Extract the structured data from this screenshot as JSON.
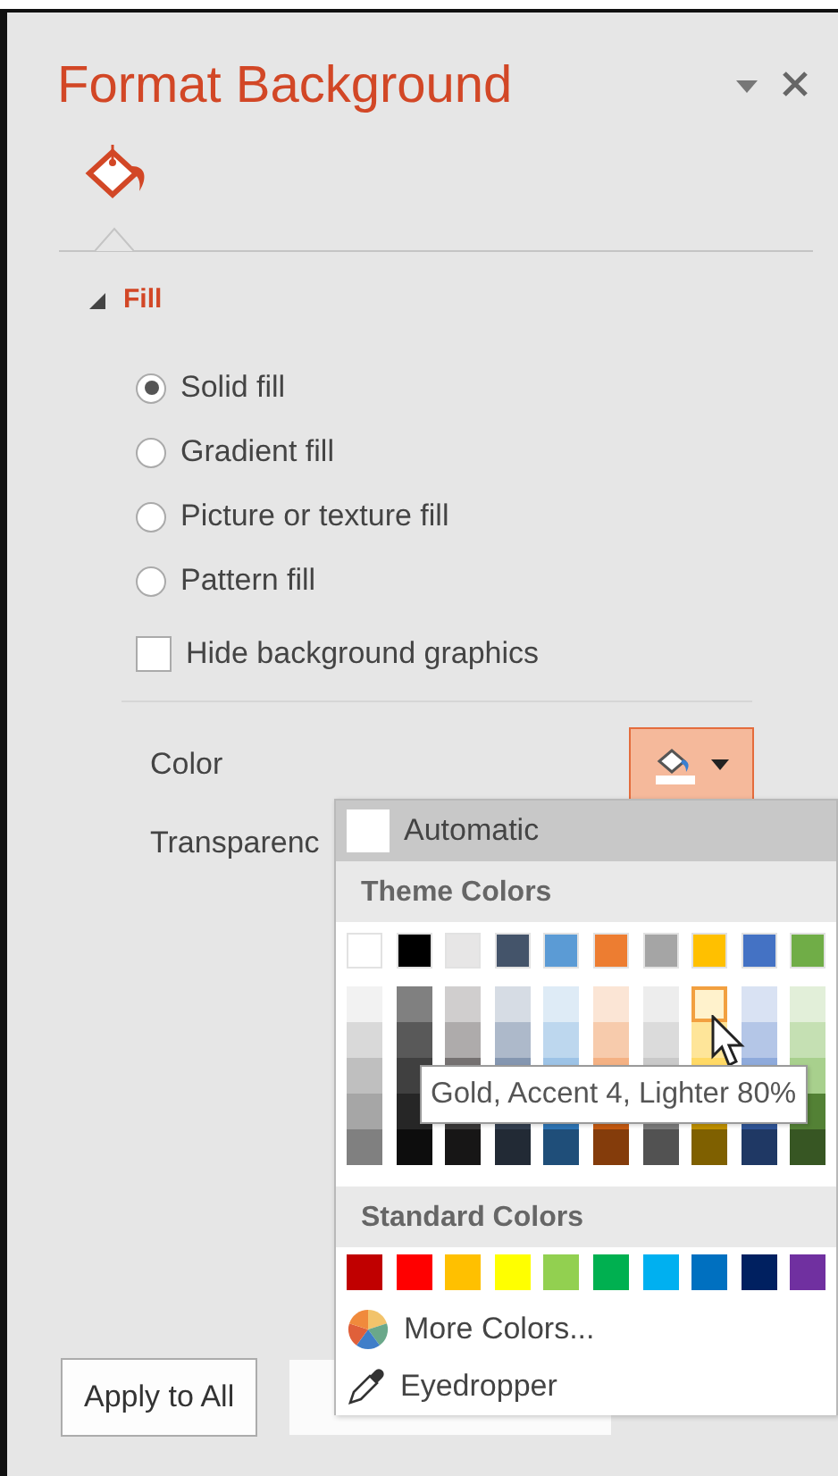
{
  "panel": {
    "title": "Format Background",
    "tabs": [
      {
        "kind": "fill",
        "selected": true
      }
    ]
  },
  "section": {
    "title": "Fill",
    "expanded": true
  },
  "fill_options": [
    {
      "label": "Solid fill",
      "selected": true
    },
    {
      "label": "Gradient fill",
      "selected": false
    },
    {
      "label": "Picture or texture fill",
      "selected": false
    },
    {
      "label": "Pattern fill",
      "selected": false
    }
  ],
  "hide_background_graphics": {
    "label": "Hide background graphics",
    "checked": false
  },
  "color": {
    "label": "Color",
    "expanded": true
  },
  "transparency": {
    "label": "Transparenc"
  },
  "buttons": [
    {
      "kind": "text",
      "label": "Apply to All"
    },
    {
      "kind": "covered"
    }
  ],
  "color_menu": {
    "automatic": {
      "label": "Automatic",
      "selected": true
    },
    "theme_colors": {
      "title": "Theme Colors",
      "columns": [
        {
          "color": "#ffffff",
          "shades": [
            {
              "color": "#f2f2f2",
              "hovered": false
            },
            {
              "color": "#d9d9d9",
              "hovered": false
            },
            {
              "color": "#bfbfbf",
              "hovered": false
            },
            {
              "color": "#a6a6a6",
              "hovered": false
            },
            {
              "color": "#808080",
              "hovered": false
            }
          ]
        },
        {
          "color": "#000000",
          "shades": [
            {
              "color": "#808080",
              "hovered": false
            },
            {
              "color": "#595959",
              "hovered": false
            },
            {
              "color": "#404040",
              "hovered": false
            },
            {
              "color": "#262626",
              "hovered": false
            },
            {
              "color": "#0d0d0d",
              "hovered": false
            }
          ]
        },
        {
          "color": "#e7e6e6",
          "shades": [
            {
              "color": "#d0cece",
              "hovered": false
            },
            {
              "color": "#aeabab",
              "hovered": false
            },
            {
              "color": "#757171",
              "hovered": false
            },
            {
              "color": "#3a3838",
              "hovered": false
            },
            {
              "color": "#171616",
              "hovered": false
            }
          ]
        },
        {
          "color": "#44546a",
          "shades": [
            {
              "color": "#d6dce4",
              "hovered": false
            },
            {
              "color": "#adb9ca",
              "hovered": false
            },
            {
              "color": "#8496b0",
              "hovered": false
            },
            {
              "color": "#333f4f",
              "hovered": false
            },
            {
              "color": "#222a35",
              "hovered": false
            }
          ]
        },
        {
          "color": "#5b9bd5",
          "shades": [
            {
              "color": "#deebf6",
              "hovered": false
            },
            {
              "color": "#bdd7ee",
              "hovered": false
            },
            {
              "color": "#9dc3e6",
              "hovered": false
            },
            {
              "color": "#2e75b5",
              "hovered": false
            },
            {
              "color": "#1f4e79",
              "hovered": false
            }
          ]
        },
        {
          "color": "#ed7d31",
          "shades": [
            {
              "color": "#fbe5d5",
              "hovered": false
            },
            {
              "color": "#f7cbac",
              "hovered": false
            },
            {
              "color": "#f4b183",
              "hovered": false
            },
            {
              "color": "#c55a11",
              "hovered": false
            },
            {
              "color": "#843c0b",
              "hovered": false
            }
          ]
        },
        {
          "color": "#a5a5a5",
          "shades": [
            {
              "color": "#ededed",
              "hovered": false
            },
            {
              "color": "#dbdbdb",
              "hovered": false
            },
            {
              "color": "#c9c9c9",
              "hovered": false
            },
            {
              "color": "#7b7b7b",
              "hovered": false
            },
            {
              "color": "#525252",
              "hovered": false
            }
          ]
        },
        {
          "color": "#ffc000",
          "shades": [
            {
              "color": "#fff2cc",
              "hovered": true
            },
            {
              "color": "#fee599",
              "hovered": false
            },
            {
              "color": "#ffd965",
              "hovered": false
            },
            {
              "color": "#bf9000",
              "hovered": false
            },
            {
              "color": "#7f6000",
              "hovered": false
            }
          ]
        },
        {
          "color": "#4472c4",
          "shades": [
            {
              "color": "#d9e2f3",
              "hovered": false
            },
            {
              "color": "#b4c6e7",
              "hovered": false
            },
            {
              "color": "#8eaadb",
              "hovered": false
            },
            {
              "color": "#2f5496",
              "hovered": false
            },
            {
              "color": "#1f3864",
              "hovered": false
            }
          ]
        },
        {
          "color": "#70ad47",
          "shades": [
            {
              "color": "#e2efd9",
              "hovered": false
            },
            {
              "color": "#c5e0b3",
              "hovered": false
            },
            {
              "color": "#a8d08d",
              "hovered": false
            },
            {
              "color": "#538135",
              "hovered": false
            },
            {
              "color": "#375623",
              "hovered": false
            }
          ]
        }
      ]
    },
    "standard_colors": {
      "title": "Standard Colors",
      "swatches": [
        {
          "color": "#c00000"
        },
        {
          "color": "#ff0000"
        },
        {
          "color": "#ffc000"
        },
        {
          "color": "#ffff00"
        },
        {
          "color": "#92d050"
        },
        {
          "color": "#00b050"
        },
        {
          "color": "#00b0f0"
        },
        {
          "color": "#0070c0"
        },
        {
          "color": "#002060"
        },
        {
          "color": "#7030a0"
        }
      ]
    },
    "commands": [
      {
        "kind": "more-colors",
        "label": "More Colors..."
      },
      {
        "kind": "eyedropper",
        "label": "Eyedropper"
      }
    ],
    "tooltip": "Gold, Accent 4, Lighter 80%"
  }
}
